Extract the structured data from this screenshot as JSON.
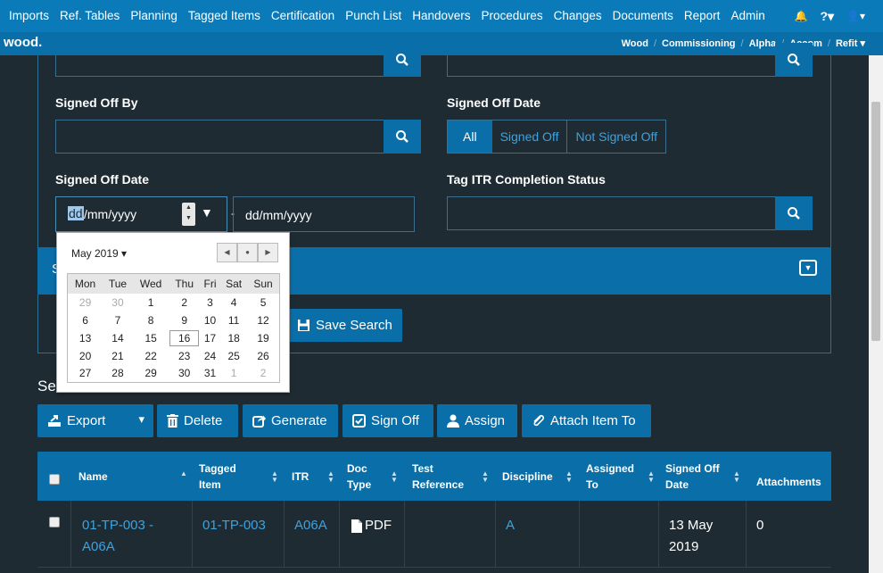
{
  "nav": {
    "items": [
      "Imports",
      "Ref. Tables",
      "Planning",
      "Tagged Items",
      "Certification",
      "Punch List",
      "Handovers",
      "Procedures",
      "Changes",
      "Documents",
      "Report",
      "Admin"
    ],
    "bell": "🔔",
    "help": "?▾",
    "user": "👤▾"
  },
  "subnav": {
    "logo": "wood.",
    "crumbs": [
      "Wood",
      "Commissioning",
      "Alpha",
      "Accom",
      "Refit ▾"
    ],
    "sep": "/"
  },
  "form": {
    "signed_off_by_label": "Signed Off By",
    "signed_off_date_label": "Signed Off Date",
    "signed_off_date_range_label": "Signed Off Date",
    "tag_itr_label": "Tag ITR Completion Status",
    "seg_all": "All",
    "seg_signed": "Signed Off",
    "seg_not_signed": "Not Signed Off",
    "date_from_hl": "dd",
    "date_from_rest": "/mm/yyyy",
    "date_to": "dd/mm/yyyy",
    "dash": "-"
  },
  "calendar": {
    "month": "May 2019 ▾",
    "days": [
      "Mon",
      "Tue",
      "Wed",
      "Thu",
      "Fri",
      "Sat",
      "Sun"
    ],
    "weeks": [
      [
        "29",
        "30",
        "1",
        "2",
        "3",
        "4",
        "5"
      ],
      [
        "6",
        "7",
        "8",
        "9",
        "10",
        "11",
        "12"
      ],
      [
        "13",
        "14",
        "15",
        "16",
        "17",
        "18",
        "19"
      ],
      [
        "20",
        "21",
        "22",
        "23",
        "24",
        "25",
        "26"
      ],
      [
        "27",
        "28",
        "29",
        "30",
        "31",
        "1",
        "2"
      ]
    ]
  },
  "bluebar": {
    "label": "S"
  },
  "save_search": "Save Search",
  "section_prefix": "Se",
  "actions": {
    "export": "Export",
    "export_caret": "▾",
    "delete": "Delete",
    "generate": "Generate",
    "signoff": "Sign Off",
    "assign": "Assign",
    "attach": "Attach Item To"
  },
  "table": {
    "headers": {
      "name": "Name",
      "tagged1": "Tagged",
      "tagged2": "Item",
      "itr": "ITR",
      "doc1": "Doc",
      "doc2": "Type",
      "test1": "Test",
      "test2": "Reference",
      "discipline": "Discipline",
      "assigned1": "Assigned",
      "assigned2": "To",
      "signed1": "Signed Off",
      "signed2": "Date",
      "attachments": "Attachments"
    },
    "row": {
      "name1": "01-TP-003 -",
      "name2": "A06A",
      "tagged": "01-TP-003",
      "itr": "A06A",
      "doc": "PDF",
      "discipline": "A",
      "date1": "13 May",
      "date2": "2019",
      "attachments": "0"
    }
  },
  "colors": {
    "nav": "#0a7ab8",
    "accent": "#0a6fa8",
    "link": "#3aa3e0",
    "bg": "#1f2b33"
  }
}
